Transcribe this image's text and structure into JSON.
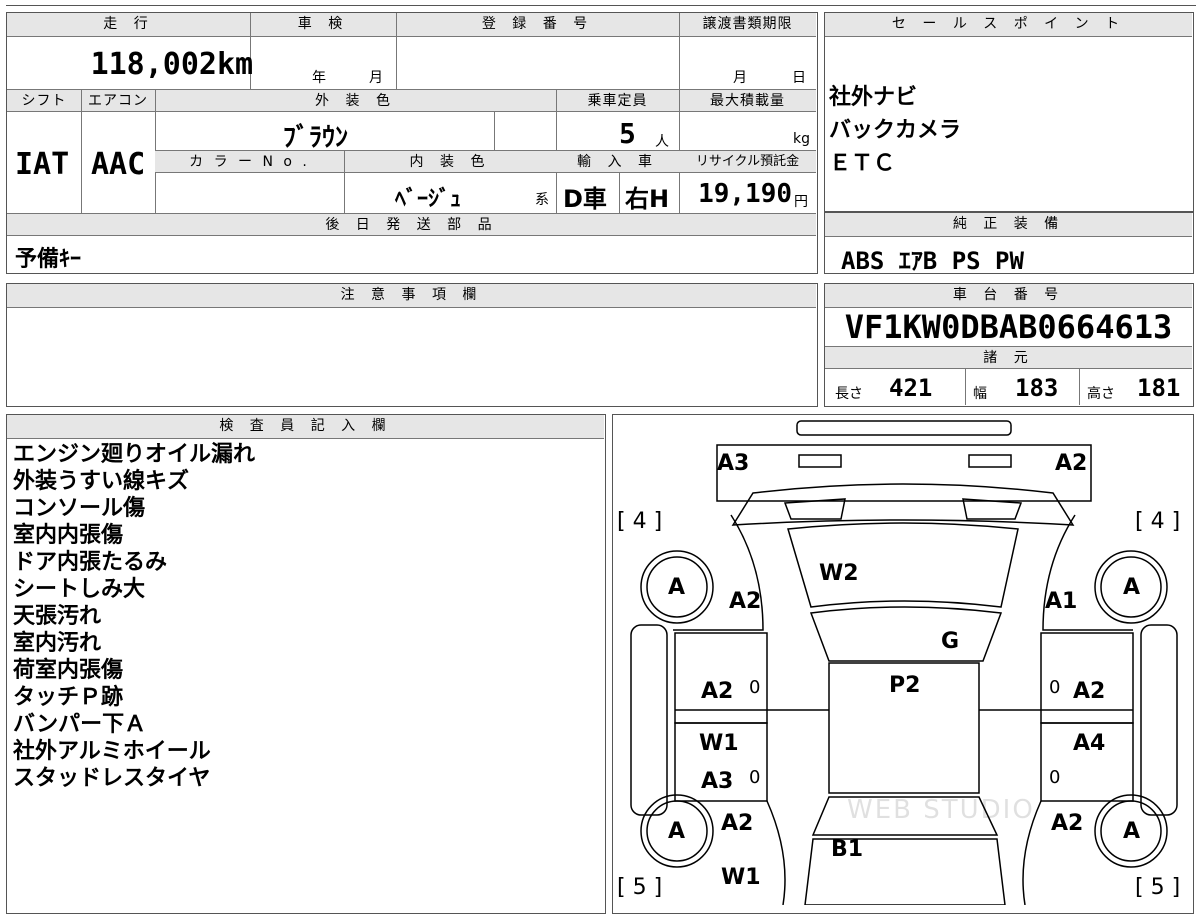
{
  "top_fragment": "登録",
  "mileage": {
    "label": "走 行",
    "value": "118,002",
    "unit": "km"
  },
  "shaken": {
    "label": "車 検",
    "year_unit": "年",
    "month_unit": "月"
  },
  "registration": {
    "label": "登 録 番 号",
    "value": ""
  },
  "transfer": {
    "label": "譲渡書類期限",
    "month_unit": "月",
    "day_unit": "日"
  },
  "shift": {
    "label": "シフト",
    "value": "IAT"
  },
  "aircon": {
    "label": "エアコン",
    "value": "AAC"
  },
  "exterior": {
    "label": "外 装 色",
    "value": "ﾌﾞﾗｳﾝ"
  },
  "capacity": {
    "label": "乗車定員",
    "value": "5",
    "unit": "人"
  },
  "max_load": {
    "label": "最大積載量",
    "unit": "kg"
  },
  "color_no": {
    "label": "カ ラ ー N o ."
  },
  "interior": {
    "label": "内 装 色",
    "value": "ﾍﾞｰｼﾞｭ",
    "suffix": "系"
  },
  "import": {
    "label": "輸 入 車",
    "value1": "D車",
    "value2": "右H"
  },
  "recycle": {
    "label": "リサイクル預託金",
    "value": "19,190",
    "unit": "円"
  },
  "later_parts": {
    "label": "後 日 発 送 部 品",
    "value": "予備ｷｰ"
  },
  "notes": {
    "label": "注 意 事 項 欄"
  },
  "sales_points": {
    "label": "セ ー ル ス ポ イ ン ト",
    "items": [
      "社外ナビ",
      "バックカメラ",
      "ＥＴＣ"
    ]
  },
  "equipment": {
    "label": "純 正 装 備",
    "value": "ABS ｴｱB PS PW"
  },
  "chassis": {
    "label": "車 台 番 号",
    "value": "VF1KW0DBAB0664613"
  },
  "specs": {
    "label": "諸 元",
    "length_label": "長さ",
    "length": "421",
    "width_label": "幅",
    "width": "183",
    "height_label": "高さ",
    "height": "181"
  },
  "inspector": {
    "label": "検 査 員 記 入 欄",
    "lines": [
      "エンジン廻りオイル漏れ",
      "外装うすい線キズ",
      "コンソール傷",
      "室内内張傷",
      "ドア内張たるみ",
      "シートしみ大",
      "天張汚れ",
      "室内汚れ",
      "荷室内張傷",
      "タッチＰ跡",
      "バンパー下Ａ",
      "社外アルミホイール",
      "スタッドレスタイヤ"
    ]
  },
  "diagram": {
    "labels": {
      "a3_top": "A3",
      "a2_top": "A2",
      "br_fl": "[ 4 ]",
      "br_fr": "[ 4 ]",
      "wheel_fl": "A",
      "wheel_fr": "A",
      "a2_fl": "A2",
      "a1_fr": "A1",
      "w2": "W2",
      "g": "G",
      "a2_ld": "A2",
      "zero_ld": "0",
      "p2": "P2",
      "zero_rd": "0",
      "a2_rd": "A2",
      "w1_l": "W1",
      "a4_r": "A4",
      "a3_lr": "A3",
      "zero_lr": "0",
      "zero_rr": "0",
      "wheel_rl": "A",
      "wheel_rr": "A",
      "a2_rl": "A2",
      "a2_rr": "A2",
      "b1": "B1",
      "w1_rear": "W1",
      "br_rl": "[ 5 ]",
      "br_rr": "[ 5 ]",
      "watermark": "WEB STUDIO"
    }
  }
}
